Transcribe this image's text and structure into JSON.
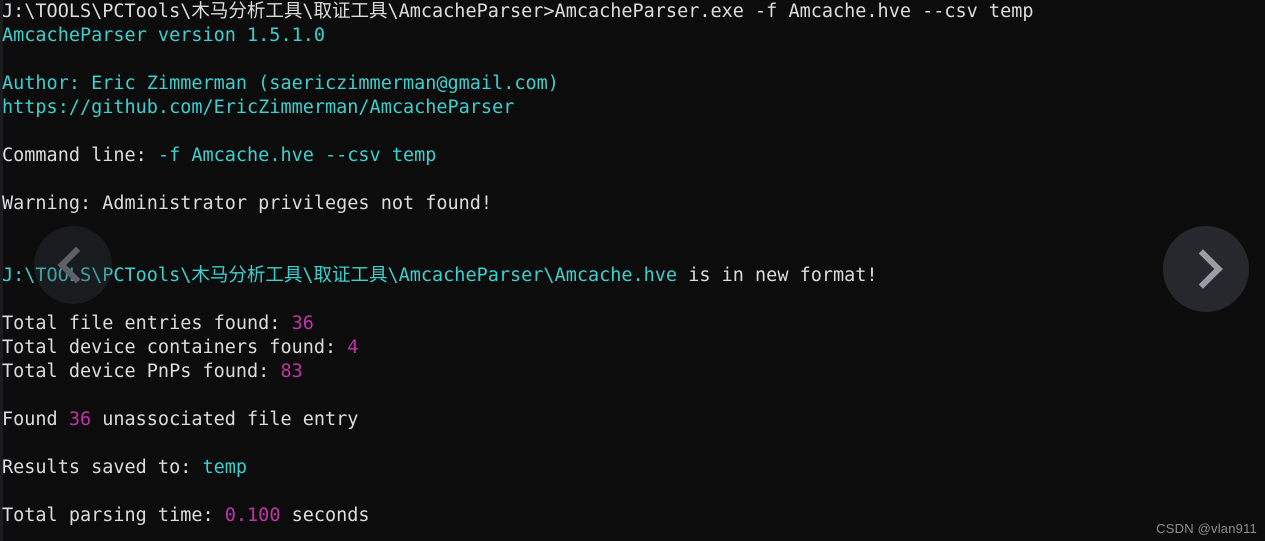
{
  "window": {
    "title": "AmcacheParser console output",
    "background_color": "#0c0c0c"
  },
  "colors": {
    "background": "#0c0c0c",
    "default_text": "#dcdcdc",
    "cyan": "#3ad1cf",
    "magenta": "#c034a8",
    "chevron_inactive": "#5d6068",
    "chevron_active": "#9a9da3",
    "watermark": "#8b8d91"
  },
  "console": {
    "lines": [
      {
        "id": "prompt-command",
        "segments": [
          {
            "text": "J:\\TOOLS\\PCTools\\木马分析工具\\取证工具\\AmcacheParser>AmcacheParser.exe -f Amcache.hve --csv temp",
            "color": "white"
          }
        ]
      },
      {
        "id": "version",
        "segments": [
          {
            "text": "AmcacheParser version 1.5.1.0",
            "color": "cyan"
          }
        ]
      },
      {
        "id": "blank-1",
        "segments": [
          {
            "text": " ",
            "color": "white"
          }
        ]
      },
      {
        "id": "author",
        "segments": [
          {
            "text": "Author: Eric Zimmerman (saericzimmerman@gmail.com)",
            "color": "cyan"
          }
        ]
      },
      {
        "id": "repo-url",
        "segments": [
          {
            "text": "https://github.com/EricZimmerman/AmcacheParser",
            "color": "cyan"
          }
        ]
      },
      {
        "id": "blank-2",
        "segments": [
          {
            "text": " ",
            "color": "white"
          }
        ]
      },
      {
        "id": "command-line",
        "segments": [
          {
            "text": "Command line: ",
            "color": "white"
          },
          {
            "text": "-f Amcache.hve --csv temp",
            "color": "cyan"
          }
        ]
      },
      {
        "id": "blank-3",
        "segments": [
          {
            "text": " ",
            "color": "white"
          }
        ]
      },
      {
        "id": "warning-admin",
        "segments": [
          {
            "text": "Warning: Administrator privileges not found!",
            "color": "white"
          }
        ]
      },
      {
        "id": "blank-4",
        "segments": [
          {
            "text": " ",
            "color": "white"
          }
        ]
      },
      {
        "id": "blank-5",
        "segments": [
          {
            "text": " ",
            "color": "white"
          }
        ]
      },
      {
        "id": "hive-format",
        "segments": [
          {
            "text": "J:\\TOOLS\\PCTools\\木马分析工具\\取证工具\\AmcacheParser\\Amcache.hve",
            "color": "cyan"
          },
          {
            "text": " is in new format!",
            "color": "white"
          }
        ]
      },
      {
        "id": "blank-6",
        "segments": [
          {
            "text": " ",
            "color": "white"
          }
        ]
      },
      {
        "id": "total-file-entries",
        "segments": [
          {
            "text": "Total file entries found: ",
            "color": "white"
          },
          {
            "text": "36",
            "color": "magenta"
          }
        ]
      },
      {
        "id": "total-device-containers",
        "segments": [
          {
            "text": "Total device containers found: ",
            "color": "white"
          },
          {
            "text": "4",
            "color": "magenta"
          }
        ]
      },
      {
        "id": "total-device-pnps",
        "segments": [
          {
            "text": "Total device PnPs found: ",
            "color": "white"
          },
          {
            "text": "83",
            "color": "magenta"
          }
        ]
      },
      {
        "id": "blank-7",
        "segments": [
          {
            "text": " ",
            "color": "white"
          }
        ]
      },
      {
        "id": "unassociated-entries",
        "segments": [
          {
            "text": "Found ",
            "color": "white"
          },
          {
            "text": "36",
            "color": "magenta"
          },
          {
            "text": " unassociated file entry",
            "color": "white"
          }
        ]
      },
      {
        "id": "blank-8",
        "segments": [
          {
            "text": " ",
            "color": "white"
          }
        ]
      },
      {
        "id": "results-saved",
        "segments": [
          {
            "text": "Results saved to: ",
            "color": "white"
          },
          {
            "text": "temp",
            "color": "cyan"
          }
        ]
      },
      {
        "id": "blank-9",
        "segments": [
          {
            "text": " ",
            "color": "white"
          }
        ]
      },
      {
        "id": "total-parsing-time",
        "segments": [
          {
            "text": "Total parsing time: ",
            "color": "white"
          },
          {
            "text": "0.100",
            "color": "magenta"
          },
          {
            "text": " seconds",
            "color": "white"
          }
        ]
      }
    ]
  },
  "overlay": {
    "prev_button": {
      "icon": "chevron-left-icon",
      "label": ""
    },
    "next_button": {
      "icon": "chevron-right-icon",
      "label": ""
    },
    "watermark": "CSDN @vlan911"
  }
}
